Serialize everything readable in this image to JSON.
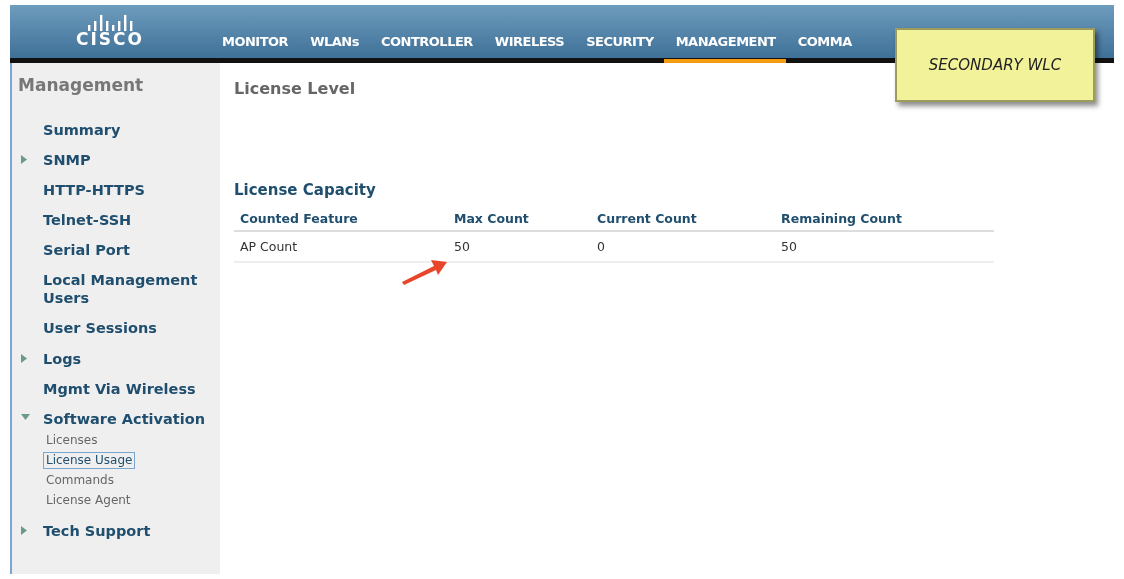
{
  "header": {
    "logo_text": "CISCO",
    "menu": [
      {
        "label": "MONITOR",
        "selected": false
      },
      {
        "label": "WLANs",
        "selected": false
      },
      {
        "label": "CONTROLLER",
        "selected": false
      },
      {
        "label": "WIRELESS",
        "selected": false
      },
      {
        "label": "SECURITY",
        "selected": false
      },
      {
        "label": "MANAGEMENT",
        "selected": true
      },
      {
        "label": "COMMA",
        "selected": false
      }
    ]
  },
  "sticky_note": {
    "text": "SECONDARY WLC"
  },
  "sidebar": {
    "title": "Management",
    "items": [
      {
        "label": "Summary",
        "kind": "plain"
      },
      {
        "label": "SNMP",
        "kind": "collapsed"
      },
      {
        "label": "HTTP-HTTPS",
        "kind": "plain"
      },
      {
        "label": "Telnet-SSH",
        "kind": "plain"
      },
      {
        "label": "Serial Port",
        "kind": "plain"
      },
      {
        "label": "Local Management Users",
        "kind": "plain"
      },
      {
        "label": "User Sessions",
        "kind": "plain"
      },
      {
        "label": "Logs",
        "kind": "collapsed"
      },
      {
        "label": "Mgmt Via Wireless",
        "kind": "plain"
      },
      {
        "label": "Software Activation",
        "kind": "expanded",
        "children": [
          {
            "label": "Licenses",
            "selected": false
          },
          {
            "label": "License Usage",
            "selected": true
          },
          {
            "label": "Commands",
            "selected": false
          },
          {
            "label": "License Agent",
            "selected": false
          }
        ]
      },
      {
        "label": "Tech Support",
        "kind": "collapsed"
      }
    ]
  },
  "content": {
    "title": "License Level",
    "section_title": "License Capacity",
    "table": {
      "columns": [
        "Counted Feature",
        "Max Count",
        "Current Count",
        "Remaining Count"
      ],
      "rows": [
        [
          "AP Count",
          "50",
          "0",
          "50"
        ]
      ]
    }
  }
}
